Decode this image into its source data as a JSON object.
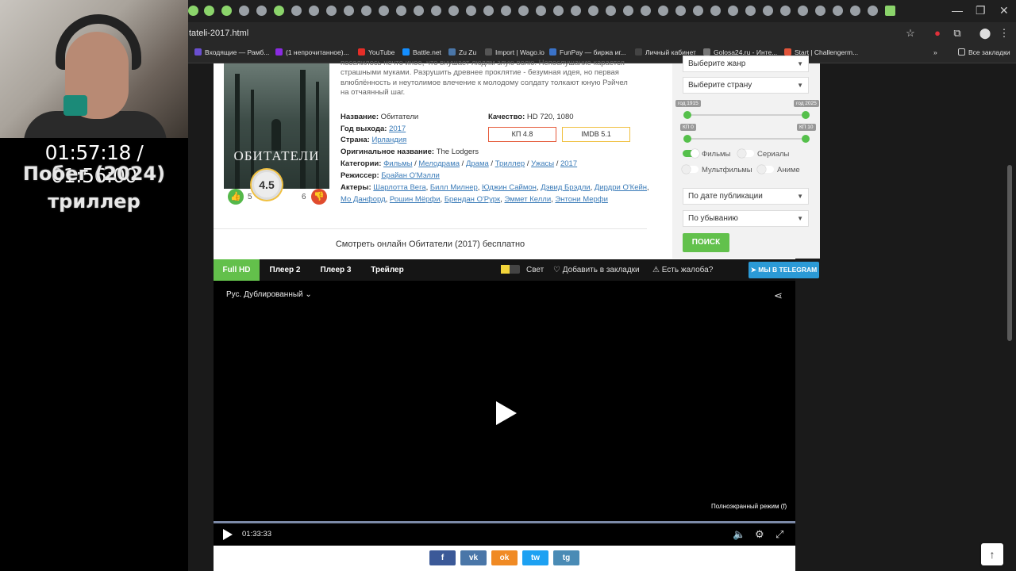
{
  "overlay": {
    "timer": "01:57:18 / 01:56:00",
    "caption1": "Побег (2024)",
    "caption2": "триллер"
  },
  "browser": {
    "url": "tateli-2017.html",
    "bookmarks": [
      "Входящие — Рамб...",
      "(1 непрочитанное)...",
      "YouTube",
      "Battle.net",
      "Zu Zu",
      "Import | Wago.io",
      "FunPay — биржа иг...",
      "Личный кабинет",
      "Golosa24.ru - Инте...",
      "Start | Challengerm..."
    ],
    "all_bookmarks": "Все закладки"
  },
  "movie": {
    "description": "поселилось нечто иное, что внушает людям злую волю. Непослушание карается страшными муками. Разрушить древнее проклятие - безумная идея, но первая влюблённость и неутолимое влечение к молодому солдату толкают юную Рэйчел на отчаянный шаг.",
    "poster_title": "ОБИТАТЕЛИ",
    "rating": "4.5",
    "likes": "5",
    "dislikes": "6",
    "name_label": "Название:",
    "name": "Обитатели",
    "year_label": "Год выхода:",
    "year": "2017",
    "country_label": "Страна:",
    "country": "Ирландия",
    "orig_label": "Оригинальное название:",
    "orig": "The Lodgers",
    "cat_label": "Категории:",
    "categories": [
      "Фильмы",
      "Мелодрама",
      "Драма",
      "Триллер",
      "Ужасы",
      "2017"
    ],
    "director_label": "Режиссер:",
    "director": "Брайан О'Мэлли",
    "actors_label": "Актеры:",
    "actors_line1": [
      "Шарлотта Вега",
      "Билл Милнер",
      "Юджин Саймон",
      "Дэвид Брэдли",
      "Дирдри О'Кейн"
    ],
    "actors_line2": [
      "Мо Данфорд",
      "Рошин Мёрфи",
      "Брендан О'Рурк",
      "Эммет Келли",
      "Энтони Мерфи"
    ],
    "quality_label": "Качество:",
    "quality": "HD 720, 1080",
    "kp": "КП 4.8",
    "imdb": "IMDB 5.1",
    "watch_title": "Смотреть онлайн Обитатели (2017) бесплатно"
  },
  "sidebar": {
    "genre": "Выберите жанр",
    "country": "Выберите страну",
    "year_from": "год 1915",
    "year_to": "год 2025",
    "kp_from": "КП 0",
    "kp_to": "КП 10",
    "films": "Фильмы",
    "series": "Сериалы",
    "cartoons": "Мультфильмы",
    "anime": "Аниме",
    "sort": "По дате публикации",
    "order": "По убыванию",
    "search": "ПОИСК"
  },
  "player": {
    "tabs": [
      "Full HD",
      "Плеер 2",
      "Плеер 3",
      "Трейлер"
    ],
    "light": "Свет",
    "bookmark": "Добавить в закладки",
    "complaint": "Есть жалоба?",
    "telegram": "МЫ В TELEGRAM",
    "audio": "Рус. Дублированный",
    "fullscreen_hint": "Полноэкранный режим (f)",
    "time": "01:33:33",
    "progress": 1.0
  },
  "share": [
    "f",
    "vk",
    "ok",
    "tw",
    "tg"
  ],
  "colors": {
    "accent": "#63c04b",
    "telegram": "#2b9ad6",
    "fb": "#3b5998",
    "vk": "#4a76a8",
    "ok": "#f08a24",
    "tw": "#1da1f2",
    "tgs": "#4a8bb5"
  }
}
